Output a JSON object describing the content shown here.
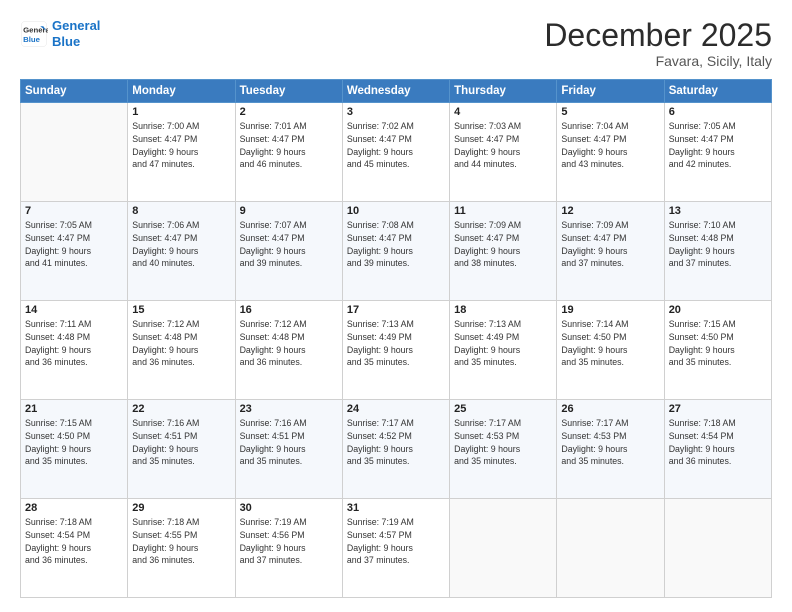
{
  "logo": {
    "line1": "General",
    "line2": "Blue"
  },
  "title": "December 2025",
  "subtitle": "Favara, Sicily, Italy",
  "headers": [
    "Sunday",
    "Monday",
    "Tuesday",
    "Wednesday",
    "Thursday",
    "Friday",
    "Saturday"
  ],
  "weeks": [
    [
      {
        "day": "",
        "detail": ""
      },
      {
        "day": "1",
        "detail": "Sunrise: 7:00 AM\nSunset: 4:47 PM\nDaylight: 9 hours\nand 47 minutes."
      },
      {
        "day": "2",
        "detail": "Sunrise: 7:01 AM\nSunset: 4:47 PM\nDaylight: 9 hours\nand 46 minutes."
      },
      {
        "day": "3",
        "detail": "Sunrise: 7:02 AM\nSunset: 4:47 PM\nDaylight: 9 hours\nand 45 minutes."
      },
      {
        "day": "4",
        "detail": "Sunrise: 7:03 AM\nSunset: 4:47 PM\nDaylight: 9 hours\nand 44 minutes."
      },
      {
        "day": "5",
        "detail": "Sunrise: 7:04 AM\nSunset: 4:47 PM\nDaylight: 9 hours\nand 43 minutes."
      },
      {
        "day": "6",
        "detail": "Sunrise: 7:05 AM\nSunset: 4:47 PM\nDaylight: 9 hours\nand 42 minutes."
      }
    ],
    [
      {
        "day": "7",
        "detail": "Sunrise: 7:05 AM\nSunset: 4:47 PM\nDaylight: 9 hours\nand 41 minutes."
      },
      {
        "day": "8",
        "detail": "Sunrise: 7:06 AM\nSunset: 4:47 PM\nDaylight: 9 hours\nand 40 minutes."
      },
      {
        "day": "9",
        "detail": "Sunrise: 7:07 AM\nSunset: 4:47 PM\nDaylight: 9 hours\nand 39 minutes."
      },
      {
        "day": "10",
        "detail": "Sunrise: 7:08 AM\nSunset: 4:47 PM\nDaylight: 9 hours\nand 39 minutes."
      },
      {
        "day": "11",
        "detail": "Sunrise: 7:09 AM\nSunset: 4:47 PM\nDaylight: 9 hours\nand 38 minutes."
      },
      {
        "day": "12",
        "detail": "Sunrise: 7:09 AM\nSunset: 4:47 PM\nDaylight: 9 hours\nand 37 minutes."
      },
      {
        "day": "13",
        "detail": "Sunrise: 7:10 AM\nSunset: 4:48 PM\nDaylight: 9 hours\nand 37 minutes."
      }
    ],
    [
      {
        "day": "14",
        "detail": "Sunrise: 7:11 AM\nSunset: 4:48 PM\nDaylight: 9 hours\nand 36 minutes."
      },
      {
        "day": "15",
        "detail": "Sunrise: 7:12 AM\nSunset: 4:48 PM\nDaylight: 9 hours\nand 36 minutes."
      },
      {
        "day": "16",
        "detail": "Sunrise: 7:12 AM\nSunset: 4:48 PM\nDaylight: 9 hours\nand 36 minutes."
      },
      {
        "day": "17",
        "detail": "Sunrise: 7:13 AM\nSunset: 4:49 PM\nDaylight: 9 hours\nand 35 minutes."
      },
      {
        "day": "18",
        "detail": "Sunrise: 7:13 AM\nSunset: 4:49 PM\nDaylight: 9 hours\nand 35 minutes."
      },
      {
        "day": "19",
        "detail": "Sunrise: 7:14 AM\nSunset: 4:50 PM\nDaylight: 9 hours\nand 35 minutes."
      },
      {
        "day": "20",
        "detail": "Sunrise: 7:15 AM\nSunset: 4:50 PM\nDaylight: 9 hours\nand 35 minutes."
      }
    ],
    [
      {
        "day": "21",
        "detail": "Sunrise: 7:15 AM\nSunset: 4:50 PM\nDaylight: 9 hours\nand 35 minutes."
      },
      {
        "day": "22",
        "detail": "Sunrise: 7:16 AM\nSunset: 4:51 PM\nDaylight: 9 hours\nand 35 minutes."
      },
      {
        "day": "23",
        "detail": "Sunrise: 7:16 AM\nSunset: 4:51 PM\nDaylight: 9 hours\nand 35 minutes."
      },
      {
        "day": "24",
        "detail": "Sunrise: 7:17 AM\nSunset: 4:52 PM\nDaylight: 9 hours\nand 35 minutes."
      },
      {
        "day": "25",
        "detail": "Sunrise: 7:17 AM\nSunset: 4:53 PM\nDaylight: 9 hours\nand 35 minutes."
      },
      {
        "day": "26",
        "detail": "Sunrise: 7:17 AM\nSunset: 4:53 PM\nDaylight: 9 hours\nand 35 minutes."
      },
      {
        "day": "27",
        "detail": "Sunrise: 7:18 AM\nSunset: 4:54 PM\nDaylight: 9 hours\nand 36 minutes."
      }
    ],
    [
      {
        "day": "28",
        "detail": "Sunrise: 7:18 AM\nSunset: 4:54 PM\nDaylight: 9 hours\nand 36 minutes."
      },
      {
        "day": "29",
        "detail": "Sunrise: 7:18 AM\nSunset: 4:55 PM\nDaylight: 9 hours\nand 36 minutes."
      },
      {
        "day": "30",
        "detail": "Sunrise: 7:19 AM\nSunset: 4:56 PM\nDaylight: 9 hours\nand 37 minutes."
      },
      {
        "day": "31",
        "detail": "Sunrise: 7:19 AM\nSunset: 4:57 PM\nDaylight: 9 hours\nand 37 minutes."
      },
      {
        "day": "",
        "detail": ""
      },
      {
        "day": "",
        "detail": ""
      },
      {
        "day": "",
        "detail": ""
      }
    ]
  ]
}
